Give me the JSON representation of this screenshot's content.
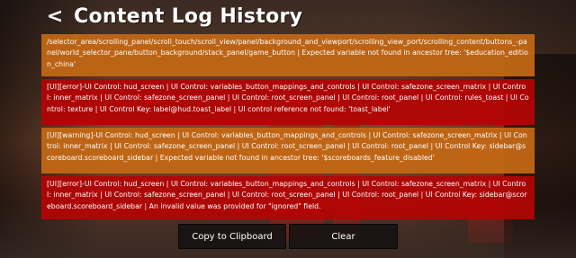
{
  "header": {
    "back_glyph": "<",
    "title": "Content Log History"
  },
  "logs": [
    {
      "level": "warning",
      "text": "/selector_area/scrolling_panel/scroll_touch/scroll_view/panel/background_and_viewport/scrolling_view_port/scrolling_content/buttons_-panel/world_selector_pane/button_background/stack_panel/game_button | Expected variable not found in ancestor tree: '$education_edition_china'"
    },
    {
      "level": "error",
      "text": "[UI][error]-UI Control: hud_screen | UI Control: variables_button_mappings_and_controls | UI Control: safezone_screen_matrix | UI Control: inner_matrix | UI Control: safezone_screen_panel | UI Control: root_screen_panel | UI Control: root_panel | UI Control: rules_toast | UI Control: texture | UI Control Key: label@hud.toast_label | UI control reference not found: 'toast_label'"
    },
    {
      "level": "warning",
      "text": "[UI][warning]-UI Control: hud_screen | UI Control: variables_button_mappings_and_controls | UI Control: safezone_screen_matrix | UI Control: inner_matrix | UI Control: safezone_screen_panel | UI Control: root_screen_panel | UI Control: root_panel | UI Control Key: sidebar@scoreboard.scoreboard_sidebar | Expected variable not found in ancestor tree: '$scoreboards_feature_disabled'"
    },
    {
      "level": "error",
      "text": "[UI][error]-UI Control: hud_screen | UI Control: variables_button_mappings_and_controls | UI Control: safezone_screen_matrix | UI Control: inner_matrix | UI Control: safezone_screen_panel | UI Control: root_screen_panel | UI Control: root_panel | UI Control Key: sidebar@scoreboard.scoreboard_sidebar | An invalid value was provided for \"ignored\" field."
    }
  ],
  "footer": {
    "copy_label": "Copy to Clipboard",
    "clear_label": "Clear"
  },
  "colors": {
    "warning": "#c46814",
    "error": "#b40404",
    "button_bg": "#141212"
  }
}
